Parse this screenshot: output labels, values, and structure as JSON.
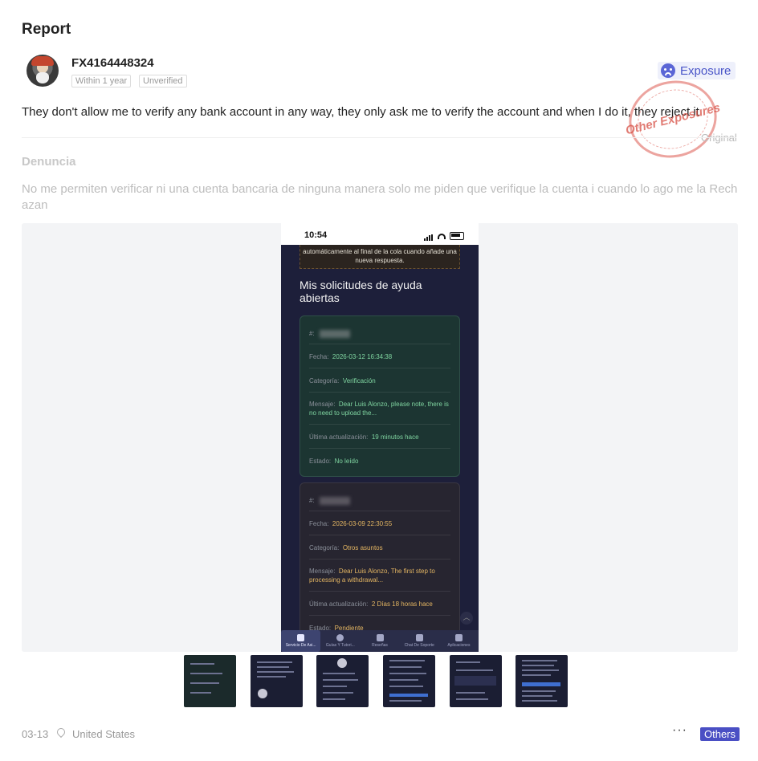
{
  "page_title": "Report",
  "user": {
    "name": "FX4164448324",
    "tags": [
      "Within 1 year",
      "Unverified"
    ]
  },
  "badge": {
    "label": "Exposure",
    "icon": "sad-face-icon",
    "color": "#4a55c8"
  },
  "post": {
    "text_en": "They don't allow me to verify any bank account in any way, they only ask me to verify the account and when I do it, they reject it",
    "stamp": "Other Exposures",
    "original_label": "Original",
    "original_title": "Denuncia",
    "original_text": "No me permiten verificar ni una cuenta bancaria de ninguna manera solo me piden que verifique la cuenta i cuando lo ago me la Rechazan"
  },
  "screenshot": {
    "time": "10:54",
    "note": "automáticamente al final de la cola cuando añade una nueva respuesta.",
    "heading": "Mis solicitudes de ayuda abiertas",
    "tickets": [
      {
        "id_label": "#:",
        "fecha_label": "Fecha:",
        "fecha": "2026-03-12 16:34:38",
        "categoria_label": "Categoría:",
        "categoria": "Verificación",
        "mensaje_label": "Mensaje:",
        "mensaje": "Dear Luis Alonzo, please note, there is no need to upload the...",
        "actualizacion_label": "Última actualización:",
        "actualizacion": "19 minutos hace",
        "estado_label": "Estado:",
        "estado": "No leído"
      },
      {
        "id_label": "#:",
        "fecha_label": "Fecha:",
        "fecha": "2026-03-09 22:30:55",
        "categoria_label": "Categoría:",
        "categoria": "Otros asuntos",
        "mensaje_label": "Mensaje:",
        "mensaje": "Dear Luis Alonzo, The first step to processing a withdrawal...",
        "actualizacion_label": "Última actualización:",
        "actualizacion": "2 Días 18 horas hace",
        "estado_label": "Estado:",
        "estado": "Pendiente"
      }
    ],
    "tabs": [
      "Servicio De Asi...",
      "Guías Y Tutori...",
      "Reseñas",
      "Chat De Soporte",
      "Aplicaciones"
    ]
  },
  "footer": {
    "date": "03-13",
    "location": "United States",
    "category": "Others"
  }
}
